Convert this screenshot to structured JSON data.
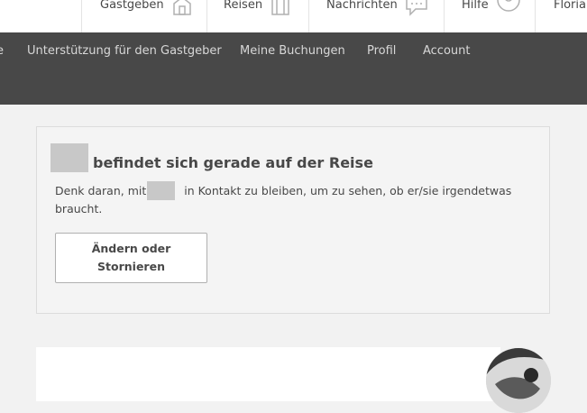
{
  "header": {
    "nav": [
      {
        "label": "Gastgeben",
        "icon": "home-icon"
      },
      {
        "label": "Reisen",
        "icon": "suitcase-icon"
      },
      {
        "label": "Nachrichten",
        "icon": "chat-icon"
      },
      {
        "label": "Hilfe",
        "icon": "user-icon"
      },
      {
        "label": "Florian"
      }
    ],
    "badge_color": "#ff5a5f"
  },
  "subnav": {
    "items": [
      {
        "label": "e"
      },
      {
        "label": "Unterstützung für den Gastgeber"
      },
      {
        "label": "Meine Buchungen"
      },
      {
        "label": "Profil"
      },
      {
        "label": "Account"
      }
    ],
    "background": "#484848"
  },
  "notice": {
    "title": "befindet sich gerade auf der Reise",
    "text_before": "Denk daran, mit",
    "text_after": "in Kontakt zu bleiben, um zu sehen, ob er/sie irgendetwas braucht.",
    "button_label": "Ändern oder Stornieren"
  }
}
